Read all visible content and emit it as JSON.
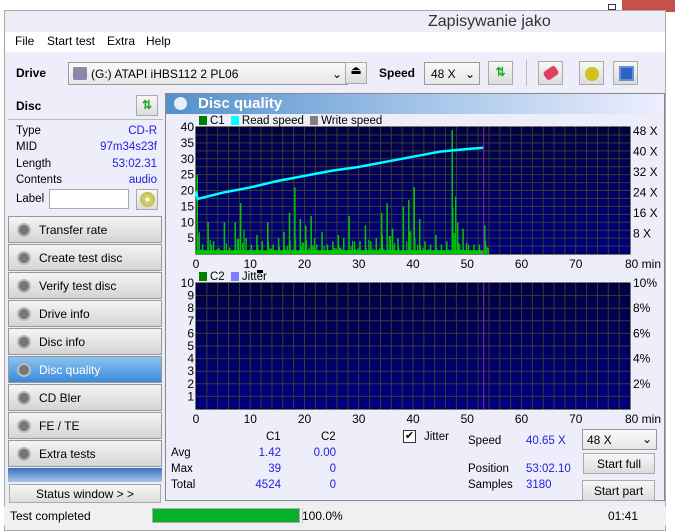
{
  "background_window": {
    "title": "Zapisywanie jako"
  },
  "menu": [
    "File",
    "Start test",
    "Extra",
    "Help"
  ],
  "toolbar": {
    "drive_label": "Drive",
    "drive_value": "(G:)   ATAPI iHBS112   2 PL06",
    "speed_label": "Speed",
    "speed_value": "48 X"
  },
  "disc": {
    "title": "Disc",
    "rows": [
      {
        "k": "Type",
        "v": "CD-R"
      },
      {
        "k": "MID",
        "v": "97m34s23f"
      },
      {
        "k": "Length",
        "v": "53:02.31"
      },
      {
        "k": "Contents",
        "v": "audio"
      }
    ],
    "label_label": "Label",
    "label_value": ""
  },
  "nav": [
    {
      "label": "Transfer rate"
    },
    {
      "label": "Create test disc"
    },
    {
      "label": "Verify test disc"
    },
    {
      "label": "Drive info"
    },
    {
      "label": "Disc info"
    },
    {
      "label": "Disc quality",
      "selected": true
    },
    {
      "label": "CD Bler"
    },
    {
      "label": "FE / TE"
    },
    {
      "label": "Extra tests"
    }
  ],
  "status_window_button": "Status window > >",
  "panel_title": "Disc quality",
  "colors": {
    "c1": "#00c800",
    "read_speed": "#00ffff",
    "write_speed": "#808080",
    "c2": "#008000",
    "jitter": "#8080ff",
    "plot_bg_top": "#000040",
    "plot_bg_bottom": "#000080",
    "position_marker": "#a020a0"
  },
  "chart_data": [
    {
      "type": "bar",
      "legend": [
        "C1",
        "Read speed",
        "Write speed"
      ],
      "x_ticks": [
        "0",
        "10",
        "20",
        "30",
        "40",
        "50",
        "60",
        "70",
        "80 min"
      ],
      "xlim": [
        0,
        80
      ],
      "y_ticks": [
        "5",
        "10",
        "15",
        "20",
        "25",
        "30",
        "35",
        "40"
      ],
      "ylim": [
        0,
        40
      ],
      "y2_ticks": [
        "8 X",
        "16 X",
        "24 X",
        "32 X",
        "40 X",
        "48 X"
      ],
      "y2lim": [
        0,
        49.6
      ],
      "grid": true,
      "position_marker_min": 53.04,
      "c1_series": {
        "name": "C1",
        "x_min": [
          0,
          1,
          2,
          3,
          4,
          5,
          6,
          7,
          8,
          9,
          10,
          11,
          12,
          13,
          14,
          15,
          16,
          17,
          18,
          19,
          20,
          21,
          22,
          23,
          24,
          25,
          26,
          27,
          28,
          29,
          30,
          31,
          32,
          33,
          34,
          35,
          36,
          37,
          38,
          39,
          40,
          41,
          42,
          43,
          44,
          45,
          46,
          47,
          48,
          49,
          50,
          51,
          52,
          53
        ],
        "values": [
          25,
          3,
          10,
          4,
          2,
          10,
          2,
          10,
          16,
          5,
          3,
          6,
          4,
          10,
          3,
          5,
          7,
          13,
          21,
          11,
          9,
          12,
          3,
          7,
          3,
          4,
          6,
          5,
          12,
          4,
          4,
          9,
          4,
          5,
          13,
          16,
          8,
          5,
          15,
          17,
          21,
          11,
          4,
          3,
          6,
          3,
          4,
          39,
          10,
          8,
          3,
          3,
          3,
          9
        ]
      },
      "read_speed_series": {
        "name": "Read speed",
        "x_min": [
          0,
          0.3,
          5,
          10,
          15,
          20,
          25,
          30,
          35,
          40,
          45,
          50,
          53
        ],
        "values_x": [
          24.5,
          21.5,
          24,
          26,
          28.5,
          30.5,
          32.5,
          34,
          36,
          38,
          40,
          41,
          41.5
        ]
      }
    },
    {
      "type": "bar",
      "legend": [
        "C2",
        "Jitter"
      ],
      "x_ticks": [
        "0",
        "10",
        "20",
        "30",
        "40",
        "50",
        "60",
        "70",
        "80 min"
      ],
      "xlim": [
        0,
        80
      ],
      "y_ticks": [
        "1",
        "2",
        "3",
        "4",
        "5",
        "6",
        "7",
        "8",
        "9",
        "10"
      ],
      "ylim": [
        0,
        10
      ],
      "y2_ticks": [
        "2%",
        "4%",
        "6%",
        "8%",
        "10%"
      ],
      "y2lim": [
        0,
        10
      ],
      "grid": true,
      "position_marker_min": 53.04,
      "c2_series": {
        "name": "C2",
        "values": []
      }
    }
  ],
  "stats": {
    "col_c1": "C1",
    "col_c2": "C2",
    "rows": [
      {
        "k": "Avg",
        "c1": "1.42",
        "c2": "0.00"
      },
      {
        "k": "Max",
        "c1": "39",
        "c2": "0"
      },
      {
        "k": "Total",
        "c1": "4524",
        "c2": "0"
      }
    ],
    "jitter_label": "Jitter",
    "jitter_checked": true,
    "speed_label": "Speed",
    "speed_value": "40.65 X",
    "speed_select": "48 X",
    "position_label": "Position",
    "position_value": "53:02.10",
    "samples_label": "Samples",
    "samples_value": "3180",
    "start_full": "Start full",
    "start_part": "Start part"
  },
  "statusbar": {
    "text": "Test completed",
    "progress": 100,
    "progress_text": "100.0%",
    "time": "01:41"
  }
}
